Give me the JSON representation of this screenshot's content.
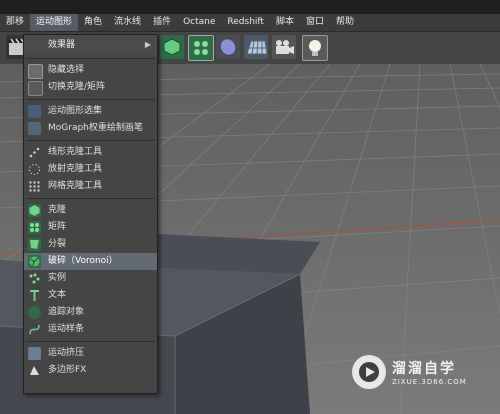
{
  "menubar": {
    "items": [
      "那移",
      "运动图形",
      "角色",
      "流水线",
      "插件",
      "Octane",
      "Redshift",
      "脚本",
      "窗口",
      "帮助"
    ],
    "active_index": 1
  },
  "menu": {
    "header": "效果器",
    "sections": [
      [
        "隐藏选择",
        "切换克隆/矩阵"
      ],
      [
        "运动图形选集",
        "MoGraph权重绘制画笔"
      ],
      [
        "线形克隆工具",
        "放射克隆工具",
        "网格克隆工具"
      ],
      [
        "克隆",
        "矩阵",
        "分裂",
        "破碎（Voronoi）",
        "实例",
        "文本",
        "追踪对象",
        "运动样条"
      ],
      [
        "运动挤压",
        "多边形FX"
      ]
    ],
    "selected": "破碎（Voronoi）"
  },
  "watermark": {
    "brand": "溜溜自学",
    "url": "ZIXUE.3D66.COM"
  },
  "colors": {
    "menu_bg": "#454545",
    "selected_bg": "#626a74",
    "accent_green": "#3aa86a"
  }
}
